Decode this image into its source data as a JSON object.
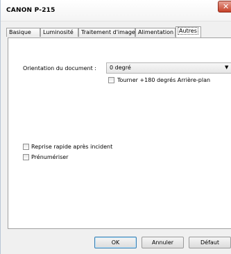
{
  "window": {
    "title": "CANON  P-215"
  },
  "tabs": [
    {
      "label": "Basique"
    },
    {
      "label": "Luminosité"
    },
    {
      "label": "Traitement d'image"
    },
    {
      "label": "Alimentation"
    },
    {
      "label": "Autres"
    }
  ],
  "orientation": {
    "label": "Orientation du document :",
    "value": "0 degré",
    "rotate_checkbox_label": "Tourner +180 degrés Arrière-plan"
  },
  "options": {
    "quick_recovery": "Reprise rapide après incident",
    "prescan": "Prénumériser"
  },
  "buttons": {
    "ok": "OK",
    "cancel": "Annuler",
    "default": "Défaut"
  },
  "colors": {
    "close_button": "#c64128",
    "panel_bg": "#ffffff",
    "window_bg": "#f0f0f0"
  },
  "icons": {
    "close": "close-icon",
    "dropdown": "chevron-down-icon"
  }
}
